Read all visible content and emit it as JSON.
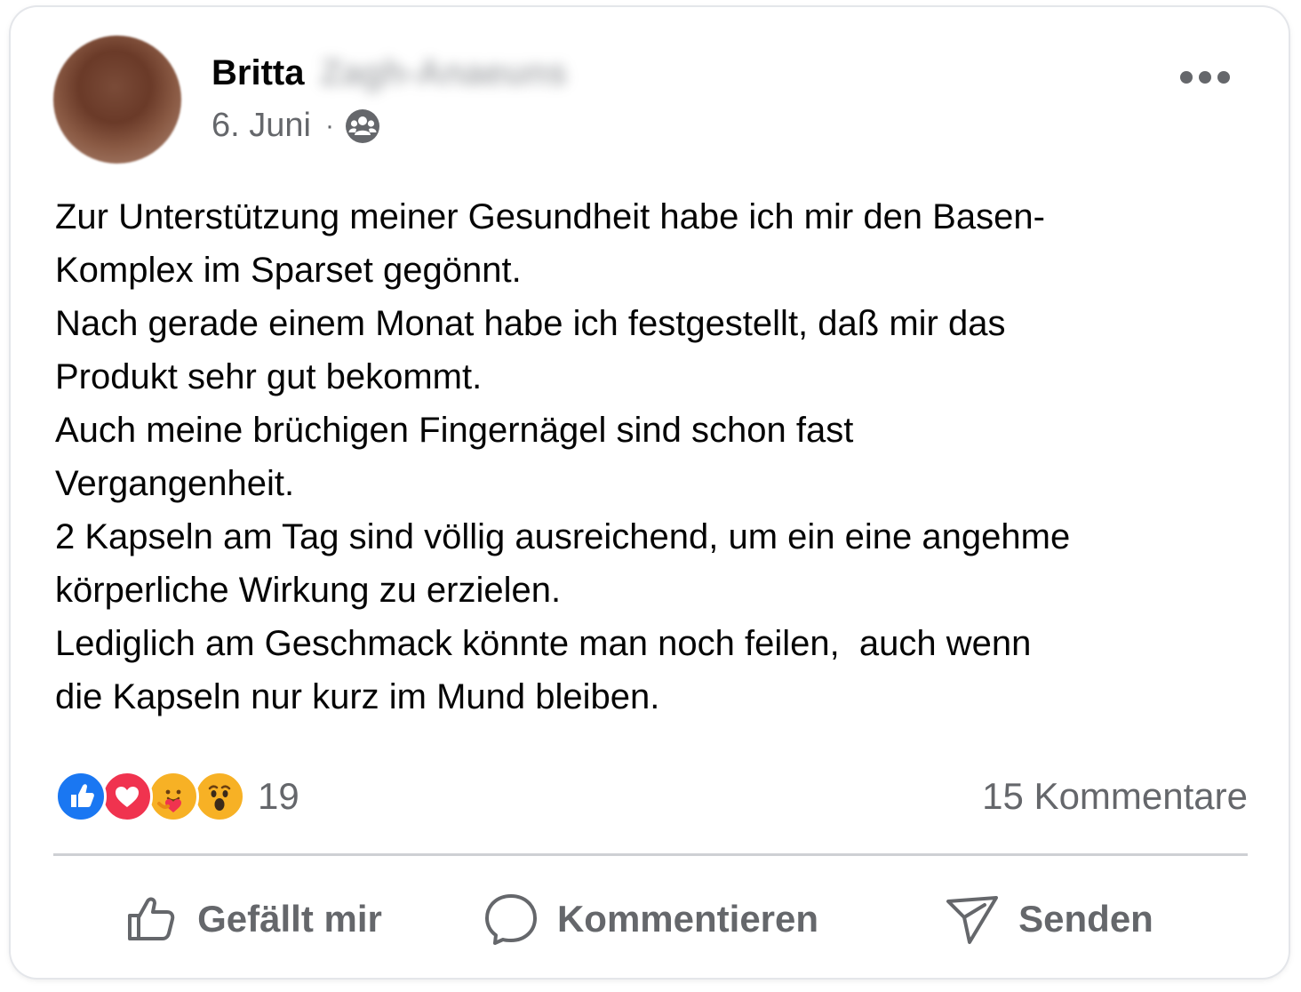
{
  "post": {
    "author_first": "Britta",
    "author_last": "Zagh-Anaeuns",
    "date": "6. Juni",
    "dot": "·",
    "privacy_icon": "group-icon",
    "more_icon": "more-icon",
    "body_lines": [
      "Zur Unterstützung meiner Gesundheit habe ich mir den Basen-",
      "Komplex im Sparset gegönnt.",
      "Nach gerade einem Monat habe ich festgestellt, daß mir das",
      "Produkt sehr gut bekommt.",
      "Auch meine brüchigen Fingernägel sind schon fast",
      "Vergangenheit.",
      "2 Kapseln am Tag sind völlig ausreichend, um ein eine angehme",
      "körperliche Wirkung zu erzielen.",
      "Lediglich am Geschmack könnte man noch feilen,  auch wenn",
      "die Kapseln nur kurz im Mund bleiben."
    ]
  },
  "reactions": {
    "icons": [
      "like-reaction-icon",
      "love-reaction-icon",
      "care-reaction-icon",
      "wow-reaction-icon"
    ],
    "count": "19",
    "comments_label": "15 Kommentare"
  },
  "actions": {
    "like_label": "Gefällt mir",
    "comment_label": "Kommentieren",
    "send_label": "Senden"
  },
  "colors": {
    "like_blue": "#1a77f2",
    "love_red": "#f0334f",
    "emoji_yellow": "#f7b125",
    "secondary_text": "#65676b"
  }
}
